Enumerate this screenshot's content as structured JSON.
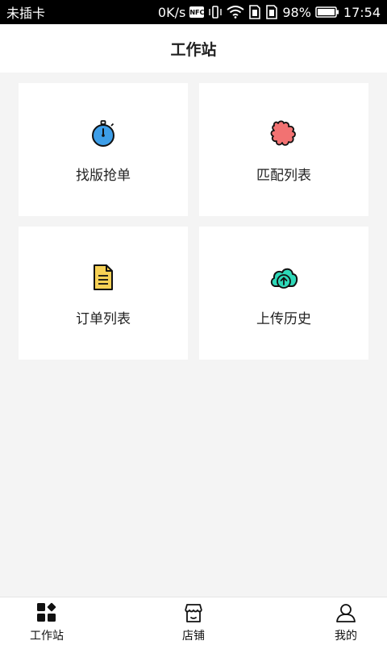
{
  "status_bar": {
    "carrier": "未插卡",
    "net_speed": "0K/s",
    "nfc": "NFC",
    "battery": "98%",
    "time": "17:54"
  },
  "header": {
    "title": "工作站"
  },
  "cards": [
    {
      "label": "找版抢单",
      "icon": "stopwatch-icon"
    },
    {
      "label": "匹配列表",
      "icon": "puzzle-icon"
    },
    {
      "label": "订单列表",
      "icon": "document-icon"
    },
    {
      "label": "上传历史",
      "icon": "cloud-upload-icon"
    }
  ],
  "bottom_nav": [
    {
      "label": "工作站",
      "icon": "workstation-icon"
    },
    {
      "label": "店铺",
      "icon": "shop-icon"
    },
    {
      "label": "我的",
      "icon": "user-icon"
    }
  ],
  "colors": {
    "stopwatch": "#3d9ee8",
    "puzzle": "#f27272",
    "document": "#f7d155",
    "cloud": "#2ed8b8"
  }
}
